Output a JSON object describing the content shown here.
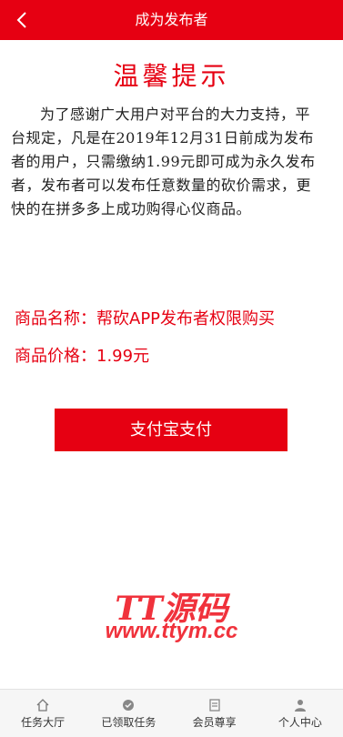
{
  "header": {
    "title": "成为发布者",
    "back_icon": "chevron-left-icon"
  },
  "notice": {
    "title": "温馨提示",
    "body": "为了感谢广大用户对平台的大力支持，平台规定，凡是在2019年12月31日前成为发布者的用户，只需缴纳1.99元即可成为永久发布者，发布者可以发布任意数量的砍价需求，更快的在拼多多上成功购得心仪商品。"
  },
  "product": {
    "name_label": "商品名称：",
    "name_value": "帮砍APP发布者权限购买",
    "price_label": "商品价格：",
    "price_value": "1.99元"
  },
  "pay_button": {
    "label": "支付宝支付"
  },
  "watermark": {
    "brand": "TT源码",
    "url": "www.ttym.cc"
  },
  "tabbar": {
    "items": [
      {
        "label": "任务大厅",
        "icon": "home-icon"
      },
      {
        "label": "已领取任务",
        "icon": "task-icon"
      },
      {
        "label": "会员尊享",
        "icon": "member-icon"
      },
      {
        "label": "个人中心",
        "icon": "user-icon"
      }
    ]
  },
  "colors": {
    "brand_red": "#e60012",
    "watermark_red": "#f0323c",
    "tabbar_bg": "#f6f6f6"
  }
}
